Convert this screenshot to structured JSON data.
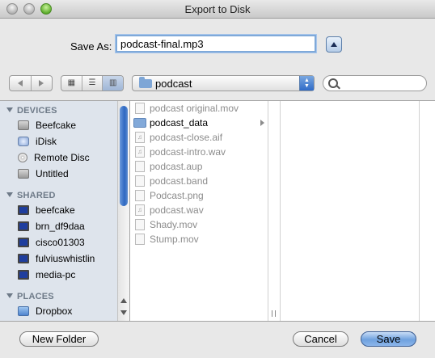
{
  "window": {
    "title": "Export to Disk"
  },
  "save_as": {
    "label": "Save As:",
    "value": "podcast-final.mp3"
  },
  "toolbar": {
    "location": "podcast",
    "search_placeholder": ""
  },
  "sidebar": {
    "sections": [
      {
        "title": "DEVICES",
        "items": [
          "Beefcake",
          "iDisk",
          "Remote Disc",
          "Untitled"
        ]
      },
      {
        "title": "SHARED",
        "items": [
          "beefcake",
          "brn_df9daa",
          "cisco01303",
          "fulviuswhistlin",
          "media-pc"
        ]
      },
      {
        "title": "PLACES",
        "items": [
          "Dropbox"
        ]
      }
    ]
  },
  "files": [
    {
      "name": "podcast original.mov",
      "kind": "file"
    },
    {
      "name": "podcast_data",
      "kind": "folder"
    },
    {
      "name": "podcast-close.aif",
      "kind": "audio"
    },
    {
      "name": "podcast-intro.wav",
      "kind": "audio"
    },
    {
      "name": "podcast.aup",
      "kind": "file"
    },
    {
      "name": "podcast.band",
      "kind": "file"
    },
    {
      "name": "Podcast.png",
      "kind": "image"
    },
    {
      "name": "podcast.wav",
      "kind": "audio"
    },
    {
      "name": "Shady.mov",
      "kind": "file"
    },
    {
      "name": "Stump.mov",
      "kind": "file"
    }
  ],
  "buttons": {
    "new_folder": "New Folder",
    "cancel": "Cancel",
    "save": "Save"
  }
}
